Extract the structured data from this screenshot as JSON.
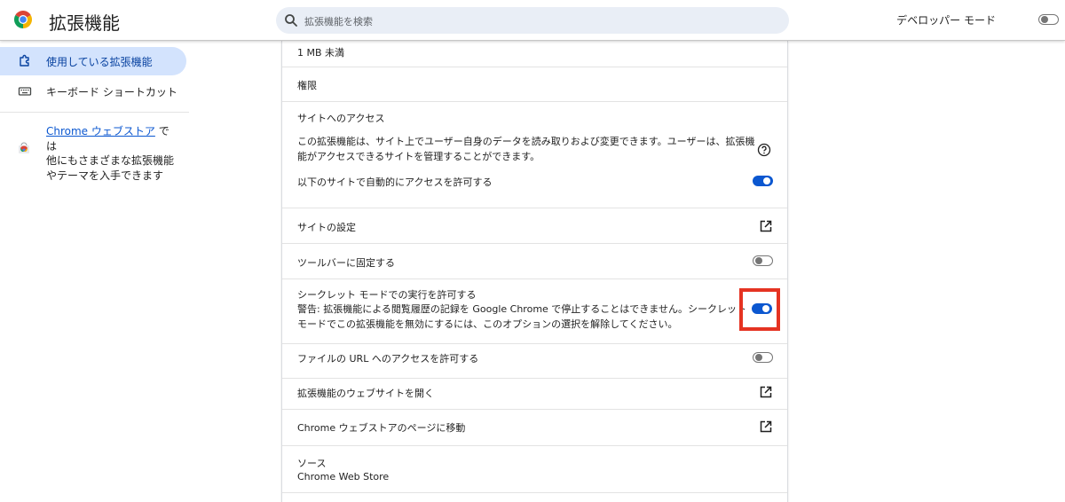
{
  "header": {
    "title": "拡張機能",
    "search_placeholder": "拡張機能を検索",
    "dev_mode_label": "デベロッパー モード",
    "dev_mode_on": false
  },
  "sidebar": {
    "items": [
      {
        "label": "使用している拡張機能",
        "icon": "puzzle-icon",
        "active": true
      },
      {
        "label": "キーボード ショートカット",
        "icon": "keyboard-icon",
        "active": false
      }
    ],
    "store_link": "Chrome ウェブストア",
    "store_text_1": " では",
    "store_text_2": "他にもさまざまな拡張機能",
    "store_text_3": "やテーマを入手できます"
  },
  "details": {
    "size": "1 MB 未満",
    "permissions_label": "権限",
    "site_access_label": "サイトへのアクセス",
    "site_access_desc_1": "この拡張機能は、サイト上でユーザー自身のデータを読み取りおよび変更できます。ユーザーは、拡張機",
    "site_access_desc_2": "能がアクセスできるサイトを管理することができます。",
    "auto_allow_label": "以下のサイトで自動的にアクセスを許可する",
    "auto_allow_on": true,
    "site_settings_label": "サイトの設定",
    "pin_toolbar_label": "ツールバーに固定する",
    "pin_toolbar_on": false,
    "incognito_label": "シークレット モードでの実行を許可する",
    "incognito_warning_1": "警告: 拡張機能による閲覧履歴の記録を Google Chrome で停止することはできません。シークレット",
    "incognito_warning_2": "モードでこの拡張機能を無効にするには、このオプションの選択を解除してください。",
    "incognito_on": true,
    "file_url_label": "ファイルの URL へのアクセスを許可する",
    "file_url_on": false,
    "open_website_label": "拡張機能のウェブサイトを開く",
    "store_page_label": "Chrome ウェブストアのページに移動",
    "source_label": "ソース",
    "source_value": "Chrome Web Store"
  },
  "colors": {
    "accent": "#0b57d0",
    "active_nav_bg": "#d3e3fd",
    "search_bg": "#e9eef6",
    "highlight": "#e53322"
  }
}
